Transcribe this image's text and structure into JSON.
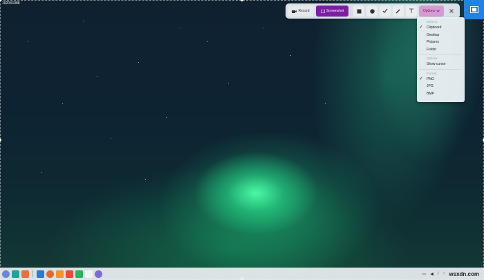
{
  "selection": {
    "size_text": "1920X1088"
  },
  "toolbar": {
    "record_label": "Record",
    "screenshot_label": "Screenshot",
    "options_label": "Options",
    "tools": [
      "rectangle-icon",
      "ellipse-icon",
      "check-mark-icon",
      "pen-icon",
      "text-icon"
    ]
  },
  "menu": {
    "save_header": "Save to",
    "save_items": [
      {
        "label": "Clipboard",
        "checked": true
      },
      {
        "label": "Desktop",
        "checked": false
      },
      {
        "label": "Pictures",
        "checked": false
      },
      {
        "label": "Folder",
        "checked": false
      }
    ],
    "options_header": "Options",
    "options_items": [
      {
        "label": "Show cursor",
        "checked": false
      }
    ],
    "format_header": "Format",
    "format_items": [
      {
        "label": "PNG",
        "checked": true
      },
      {
        "label": "JPG",
        "checked": false
      },
      {
        "label": "BMP",
        "checked": false
      }
    ]
  },
  "taskbar": {
    "apps": [
      {
        "name": "launcher-icon",
        "color": "#6b86d8"
      },
      {
        "name": "multitask-icon",
        "color": "#20a39e"
      },
      {
        "name": "app-store-icon",
        "color": "#e9713b"
      },
      {
        "name": "file-manager-icon",
        "color": "#2b7bd4"
      },
      {
        "name": "browser-icon",
        "color": "#e06a2a"
      },
      {
        "name": "music-icon",
        "color": "#f0942c"
      },
      {
        "name": "calendar-icon",
        "color": "#e84b3c"
      },
      {
        "name": "chat-icon",
        "color": "#2bb360"
      },
      {
        "name": "notes-icon",
        "color": "#f2f2f2"
      },
      {
        "name": "system-icon",
        "color": "#7c6bd8"
      }
    ],
    "watermark": "wsxdn.com"
  }
}
